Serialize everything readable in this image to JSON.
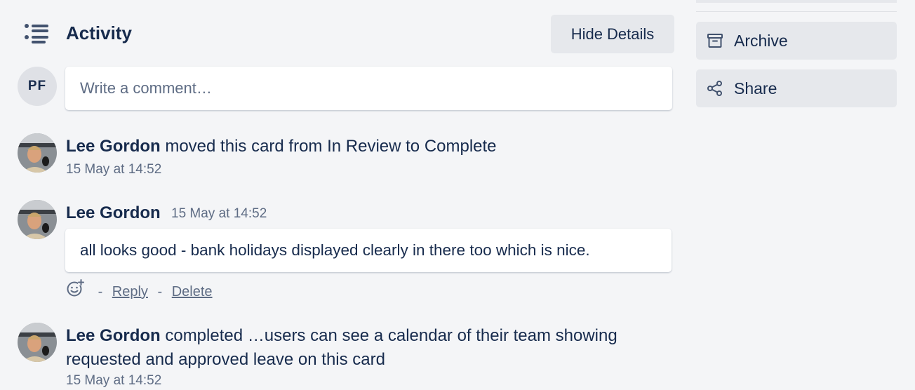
{
  "activity": {
    "title": "Activity",
    "hide_details_label": "Hide Details"
  },
  "comment": {
    "user_initials": "PF",
    "placeholder": "Write a comment…"
  },
  "entries": [
    {
      "user": "Lee Gordon",
      "text": "moved this card from In Review to Complete",
      "timestamp": "15 May at 14:52"
    },
    {
      "user": "Lee Gordon",
      "timestamp": "15 May at 14:52",
      "comment": "all looks good - bank holidays displayed clearly in there too which is nice.",
      "actions": {
        "separator": "-",
        "reply": "Reply",
        "delete": "Delete"
      }
    },
    {
      "user": "Lee Gordon",
      "text_line1": "completed …users can see a calendar of their team showing",
      "text_line2": "requested and approved leave on this card",
      "timestamp": "15 May at 14:52"
    }
  ],
  "sidebar": {
    "archive_label": "Archive",
    "share_label": "Share"
  },
  "icons": {
    "activity": "activity-list-icon",
    "reaction": "add-reaction-icon",
    "archive": "archive-icon",
    "share": "share-icon"
  },
  "colors": {
    "background": "#f4f5f7",
    "text": "#172b4d",
    "muted": "#5e6c84",
    "button": "#e6e8ec"
  }
}
